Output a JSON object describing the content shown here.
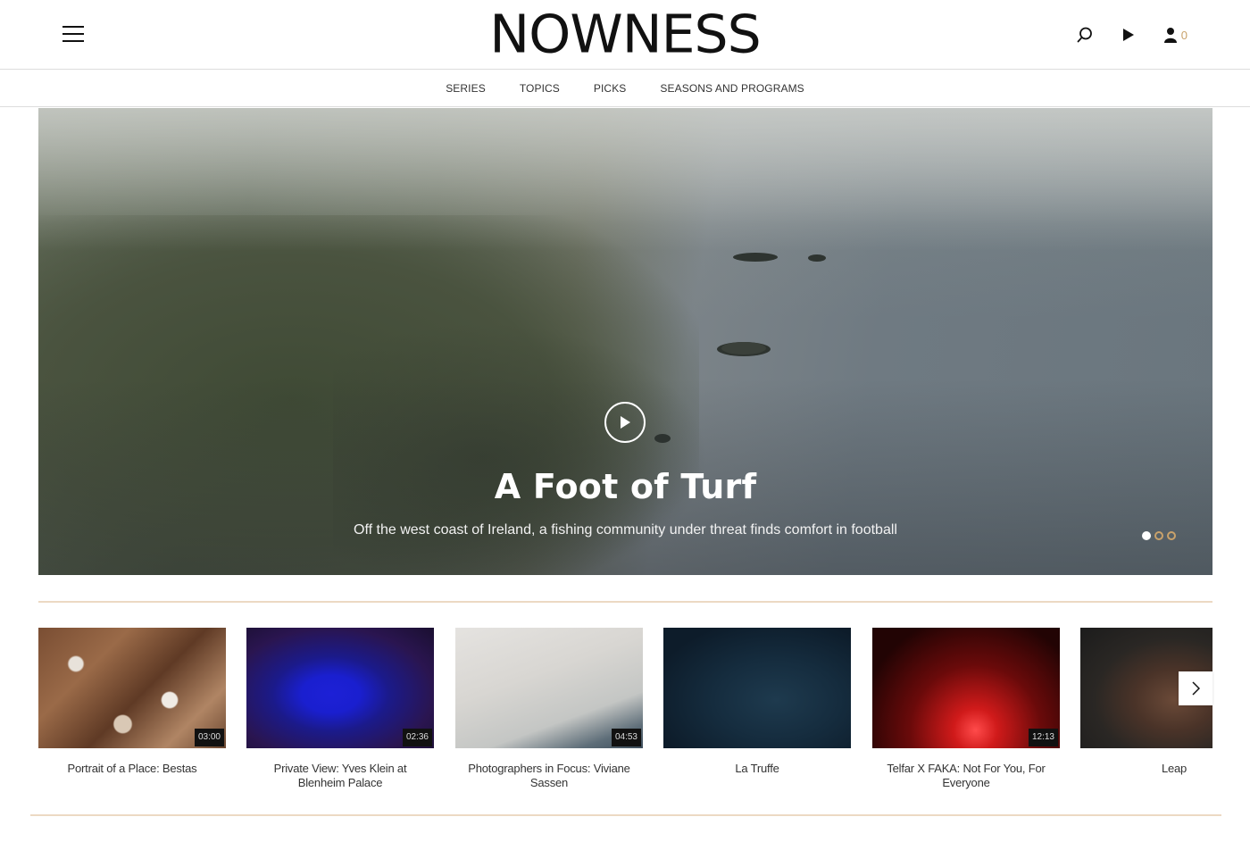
{
  "header": {
    "logo": "NOWNESS",
    "cart_count": "0",
    "icons": [
      "menu-icon",
      "search-icon",
      "play-icon",
      "user-icon"
    ]
  },
  "nav": {
    "items": [
      {
        "label": "SERIES"
      },
      {
        "label": "TOPICS"
      },
      {
        "label": "PICKS"
      },
      {
        "label": "SEASONS AND PROGRAMS"
      }
    ]
  },
  "hero": {
    "title": "A Foot of Turf",
    "subtitle": "Off the west coast of Ireland, a fishing community under threat finds comfort in football",
    "slide_count": 3,
    "active_slide": 1
  },
  "cards": [
    {
      "title": "Portrait of a Place: Bestas",
      "duration": "03:00"
    },
    {
      "title": "Private View: Yves Klein at Blenheim Palace",
      "duration": "02:36"
    },
    {
      "title": "Photographers in Focus: Viviane Sassen",
      "duration": "04:53"
    },
    {
      "title": "La Truffe",
      "duration": ""
    },
    {
      "title": "Telfar X FAKA: Not For You, For Everyone",
      "duration": "12:13"
    },
    {
      "title": "Leap",
      "duration": ""
    }
  ],
  "colors": {
    "accent": "#c9a26b",
    "rule": "#ecd9c3"
  }
}
